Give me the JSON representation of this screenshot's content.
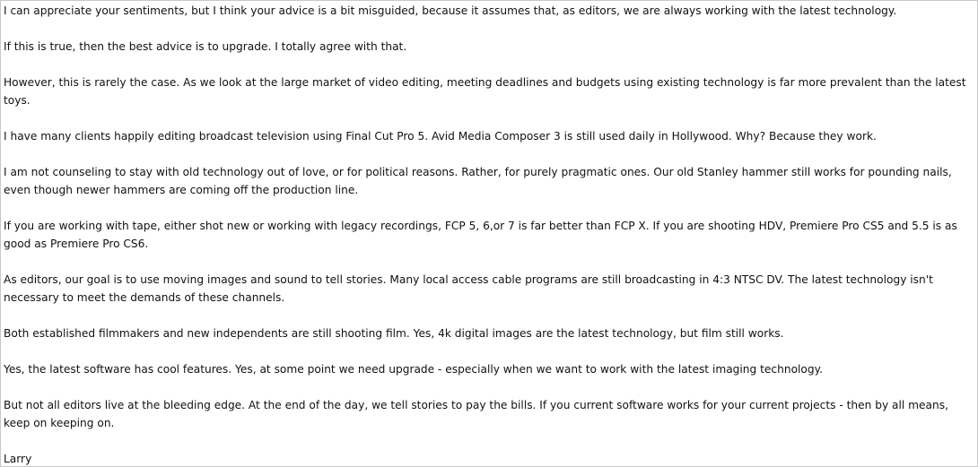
{
  "message": {
    "paragraphs": [
      "I can appreciate your sentiments, but I think your advice is a bit misguided, because it assumes that, as editors, we are always working with the latest technology.",
      "If this is true, then the best advice is to upgrade. I totally agree with that.",
      "However, this is rarely the case. As we look at the large market of video editing, meeting deadlines and budgets using existing technology is far more prevalent than the latest toys.",
      "I have many clients happily editing broadcast television using Final Cut Pro 5. Avid Media Composer 3 is still used daily in Hollywood. Why? Because they work.",
      "I am not counseling to stay with old technology out of love, or for political reasons. Rather, for purely pragmatic ones. Our old Stanley hammer still works for pounding nails, even though newer hammers are coming off the production line.",
      "If you are working with tape, either shot new or working with legacy recordings, FCP 5, 6,or 7 is far better than FCP X.  If you are shooting HDV, Premiere Pro CS5 and 5.5 is as good as Premiere Pro CS6.",
      "As editors, our goal is to use moving images and sound to tell stories. Many local access cable programs are still broadcasting in 4:3 NTSC DV. The latest technology isn't necessary to meet the demands of these channels.",
      "Both established filmmakers and new independents are still shooting film.  Yes, 4k digital images are the latest technology, but film still works.",
      "Yes, the latest software has cool features. Yes, at some point we need upgrade - especially when we want to work with the latest imaging technology.",
      "But not all editors live at the bleeding edge. At the end of the day, we tell stories to pay the bills. If you current software works for your current projects - then by all means, keep on keeping on."
    ],
    "signature": "Larry"
  }
}
